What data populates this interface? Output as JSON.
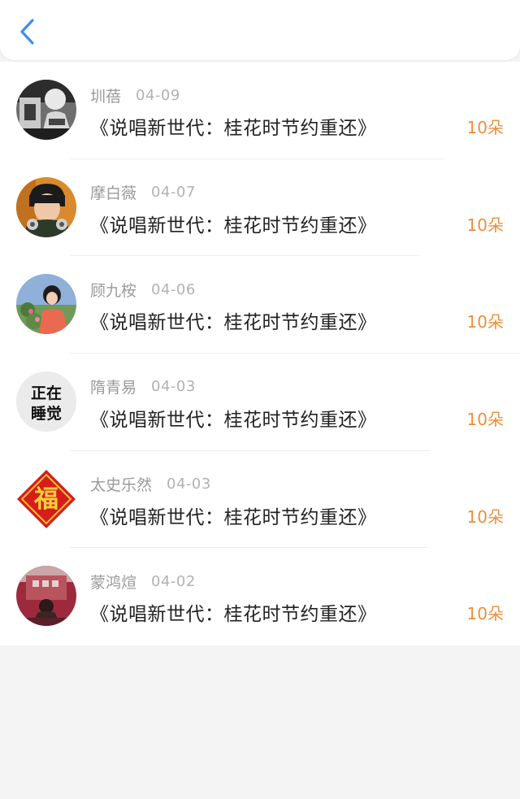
{
  "header": {
    "back_icon": "chevron-left-icon",
    "accent_color": "#3d8ef0"
  },
  "gift_color": "#ef8e3d",
  "items": [
    {
      "name": "圳蓓",
      "date": "04-09",
      "title": "《说唱新世代：桂花时节约重还》",
      "gift": "10朵"
    },
    {
      "name": "摩白薇",
      "date": "04-07",
      "title": "《说唱新世代：桂花时节约重还》",
      "gift": "10朵"
    },
    {
      "name": "顾九桉",
      "date": "04-06",
      "title": "《说唱新世代：桂花时节约重还》",
      "gift": "10朵"
    },
    {
      "name": "隋青易",
      "date": "04-03",
      "title": "《说唱新世代：桂花时节约重还》",
      "gift": "10朵",
      "avatar_text": [
        "正在",
        "睡觉"
      ]
    },
    {
      "name": "太史乐然",
      "date": "04-03",
      "title": "《说唱新世代：桂花时节约重还》",
      "gift": "10朵",
      "avatar_text": [
        "福"
      ]
    },
    {
      "name": "蒙鸿煊",
      "date": "04-02",
      "title": "《说唱新世代：桂花时节约重还》",
      "gift": "10朵"
    }
  ]
}
